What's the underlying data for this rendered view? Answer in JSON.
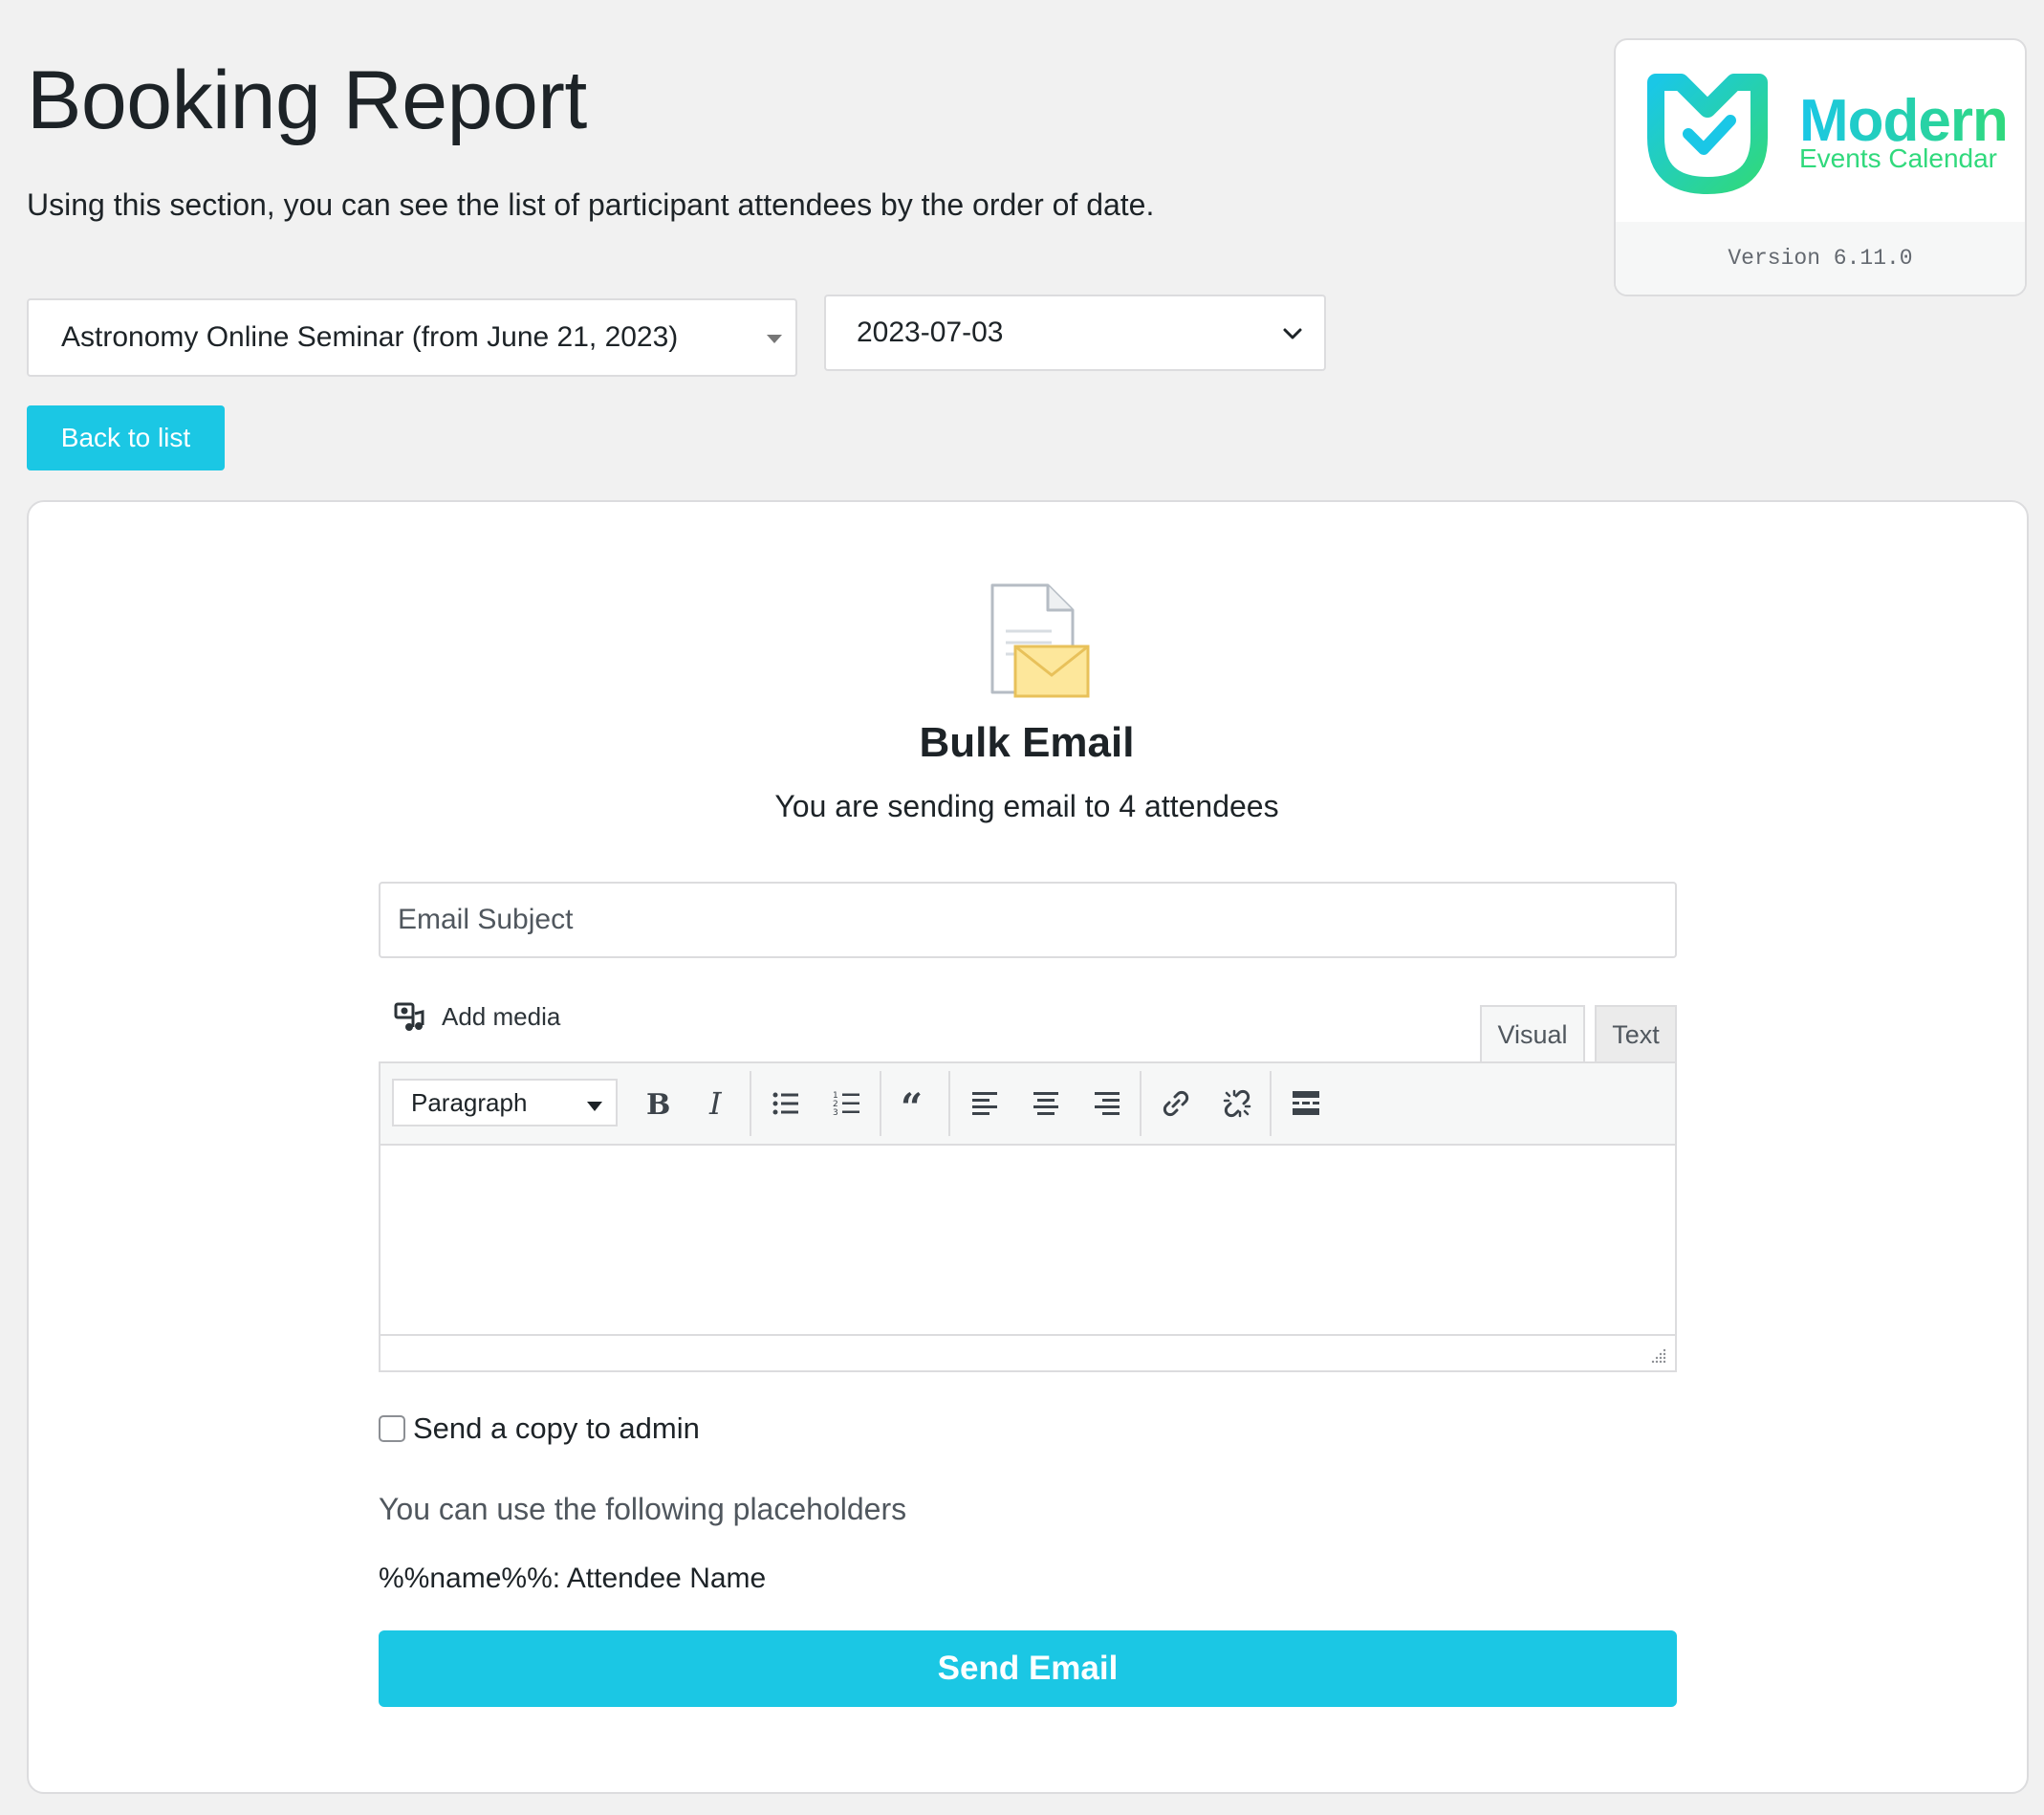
{
  "page": {
    "title": "Booking Report",
    "description": "Using this section, you can see the list of participant attendees by the order of date."
  },
  "logo": {
    "brand_line1": "Modern",
    "brand_line2": "Events Calendar",
    "version": "Version 6.11.0",
    "colors": {
      "cyan": "#1ac7e6",
      "green": "#30d97c"
    }
  },
  "filters": {
    "event_selected": "Astronomy Online Seminar (from June 21, 2023)",
    "date_selected": "2023-07-03"
  },
  "back_button": {
    "label": "Back to list"
  },
  "bulk_email": {
    "icon": "document-envelope-icon",
    "title": "Bulk Email",
    "subtitle": "You are sending email to 4 attendees",
    "subject_placeholder": "Email Subject",
    "subject_value": "",
    "add_media_label": "Add media",
    "tabs": {
      "visual": "Visual",
      "text": "Text"
    },
    "format_select": "Paragraph",
    "toolbar_icons": [
      "bold-icon",
      "italic-icon",
      "bulleted-list-icon",
      "numbered-list-icon",
      "blockquote-icon",
      "align-left-icon",
      "align-center-icon",
      "align-right-icon",
      "insert-link-icon",
      "remove-link-icon",
      "read-more-icon"
    ],
    "copy_admin_label": "Send a copy to admin",
    "copy_admin_checked": false,
    "placeholders_title": "You can use the following placeholders",
    "placeholders": [
      {
        "text": "%%name%%: Attendee Name"
      }
    ],
    "send_label": "Send Email"
  },
  "colors": {
    "accent": "#1bc7e4",
    "text": "#1d2327",
    "border": "#dcdcde",
    "background": "#f1f1f1"
  }
}
